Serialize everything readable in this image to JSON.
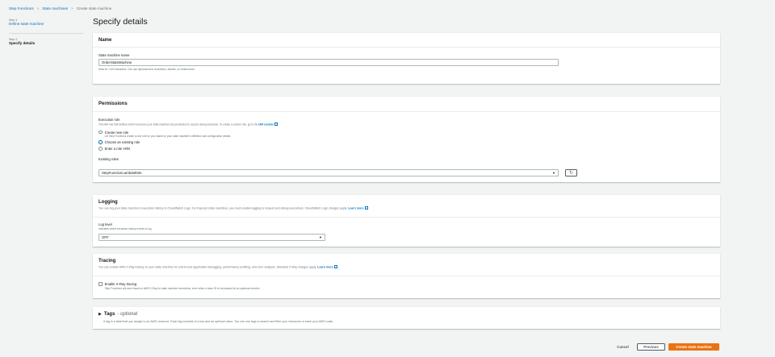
{
  "breadcrumb": [
    "Step Functions",
    "State machines",
    "Create state machine"
  ],
  "steps": [
    {
      "num": "Step 1",
      "title": "Define state machine"
    },
    {
      "num": "Step 2",
      "title": "Specify details"
    }
  ],
  "page_title": "Specify details",
  "name_section": {
    "title": "Name",
    "field_label": "State machine name",
    "value": "OrderStateMachine",
    "hint": "Must be 1-80 characters. Can use alphanumeric characters, dashes, or underscores."
  },
  "permissions": {
    "title": "Permissions",
    "exec_role_label": "Execution role",
    "exec_role_desc": "The IAM role that defines which resources your state machine has permission to access during execution. To create a custom role, go to the",
    "iam_link": "IAM console",
    "options": [
      {
        "label": "Create new role",
        "desc": "Let Step Functions create a new role for you based on your state machine's definition and configuration details.",
        "selected": false
      },
      {
        "label": "Choose an existing role",
        "desc": "",
        "selected": true
      },
      {
        "label": "Enter a role ARN",
        "desc": "",
        "selected": false
      }
    ],
    "existing_label": "Existing roles",
    "existing_value": "StepFunctionLambdaRole"
  },
  "logging": {
    "title": "Logging",
    "desc": "You can log your state machine's execution history to CloudWatch Logs. For Express state machines, you must enable logging to inspect and debug executions. CloudWatch Logs charges apply.",
    "learn_more": "Learn more",
    "level_label": "Log level",
    "level_desc": "Indicates which execution history events to log",
    "level_value": "OFF"
  },
  "tracing": {
    "title": "Tracing",
    "desc": "You can enable AWS X-Ray tracing on your state machine for end-to-end application debugging, performance profiling, and error analysis. Standard X-Ray charges apply.",
    "learn_more": "Learn more",
    "checkbox_label": "Enable X-Ray tracing",
    "checkbox_desc": "Step Functions will send traces to AWS X-Ray for state machine executions, even when a trace ID is not passed by an upstream service.",
    "enabled": false
  },
  "tags": {
    "title": "Tags",
    "optional": "- optional",
    "desc": "A tag is a label that you assign to an AWS resource. Each tag consists of a key and an optional value. You can use tags to search and filter your resources or track your AWS costs."
  },
  "footer": {
    "cancel": "Cancel",
    "previous": "Previous",
    "create": "Create state machine"
  }
}
